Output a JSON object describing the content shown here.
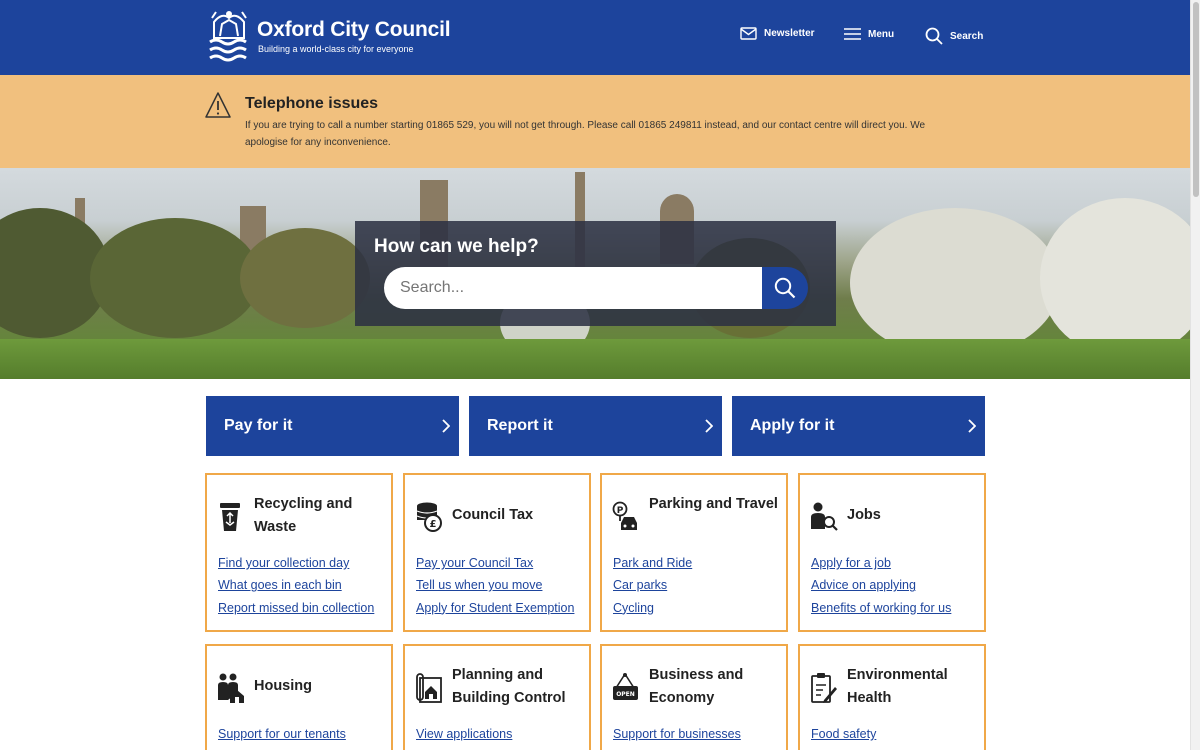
{
  "header": {
    "title": "Oxford City Council",
    "tagline": "Building a world-class city for everyone",
    "nav": [
      {
        "label": "Newsletter",
        "icon": "envelope-icon"
      },
      {
        "label": "Menu",
        "icon": "hamburger-icon"
      },
      {
        "label": "Search",
        "icon": "search-icon"
      }
    ]
  },
  "alert": {
    "title": "Telephone issues",
    "text": "If you are trying to call a number starting 01865 529, you will not get through. Please call 01865 249811 instead, and our contact centre will direct you. We apologise for any inconvenience.",
    "icon": "warning-icon"
  },
  "hero": {
    "title": "How can we help?",
    "search_placeholder": "Search..."
  },
  "actions": [
    {
      "label": "Pay for it"
    },
    {
      "label": "Report it"
    },
    {
      "label": "Apply for it"
    }
  ],
  "cards": [
    {
      "title": "Recycling and Waste",
      "icon": "recycling-bin-icon",
      "links": [
        "Find your collection day",
        "What goes in each bin",
        "Report missed bin collection"
      ]
    },
    {
      "title": "Council Tax",
      "icon": "coins-icon",
      "links": [
        "Pay your Council Tax",
        "Tell us when you move",
        "Apply for Student Exemption"
      ]
    },
    {
      "title": "Parking and Travel",
      "icon": "parking-car-icon",
      "links": [
        "Park and Ride",
        "Car parks",
        "Cycling"
      ]
    },
    {
      "title": "Jobs",
      "icon": "job-search-icon",
      "links": [
        "Apply for a job",
        "Advice on applying",
        "Benefits of working for us"
      ]
    },
    {
      "title": "Housing",
      "icon": "family-house-icon",
      "links": [
        "Support for our tenants"
      ]
    },
    {
      "title": "Planning and Building Control",
      "icon": "building-plan-icon",
      "links": [
        "View applications"
      ]
    },
    {
      "title": "Business and Economy",
      "icon": "open-sign-icon",
      "links": [
        "Support for businesses"
      ]
    },
    {
      "title": "Environmental Health",
      "icon": "clipboard-pen-icon",
      "links": [
        "Food safety"
      ]
    }
  ],
  "colors": {
    "primary": "#1d449c",
    "alert": "#f1c07e",
    "card_border": "#f0a848"
  }
}
